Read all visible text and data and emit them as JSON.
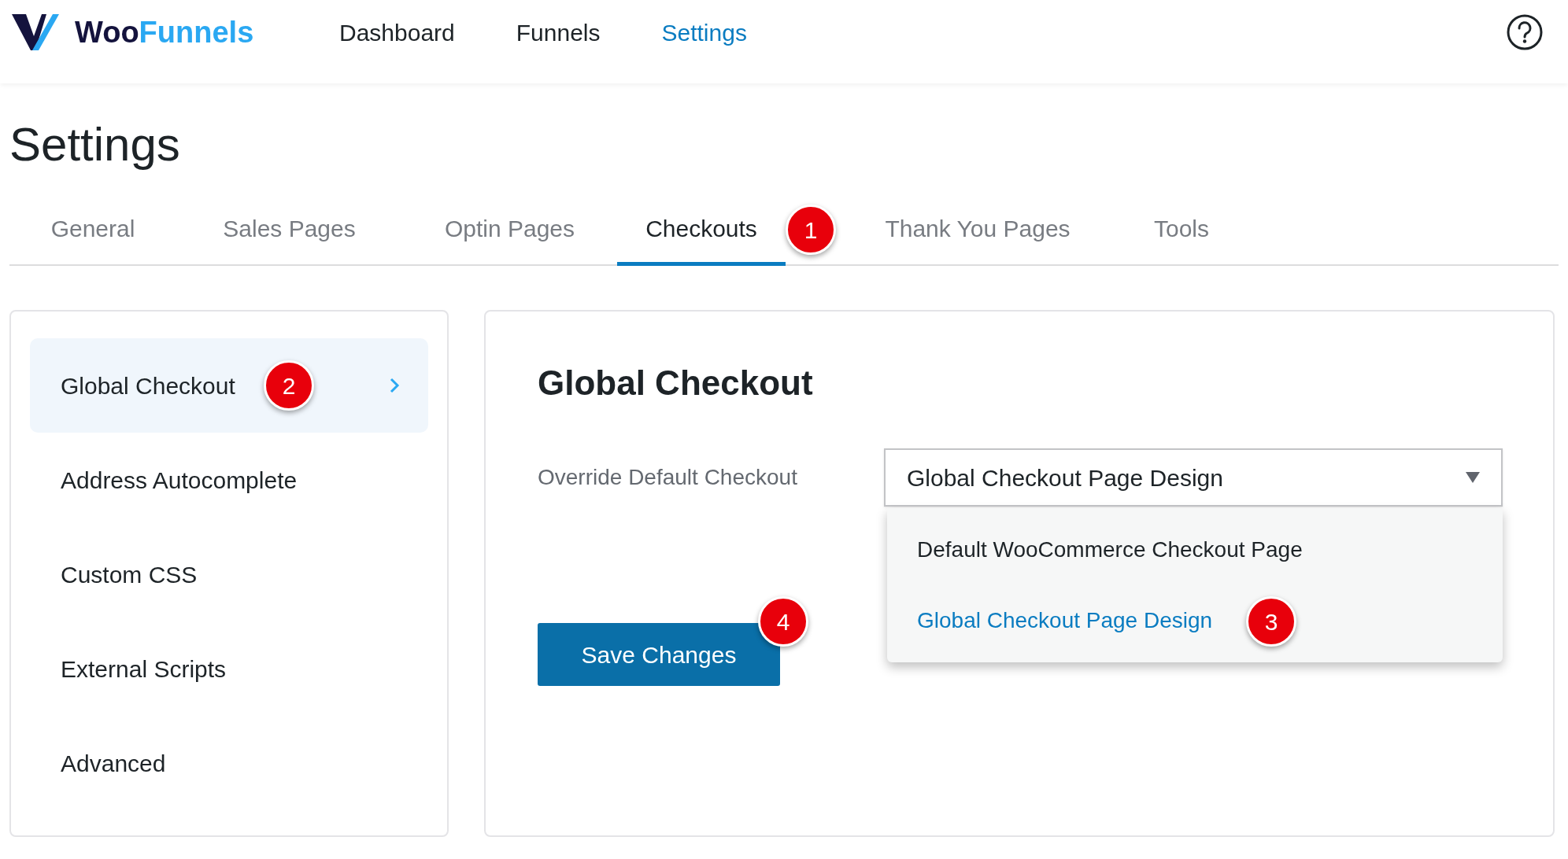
{
  "header": {
    "logo": {
      "part_1": "Woo",
      "part_2": "Funnels"
    },
    "nav": [
      {
        "label": "Dashboard",
        "selected": false
      },
      {
        "label": "Funnels",
        "selected": false
      },
      {
        "label": "Settings",
        "selected": true
      }
    ]
  },
  "page_title": "Settings",
  "tabs": [
    {
      "label": "General",
      "selected": false
    },
    {
      "label": "Sales Pages",
      "selected": false
    },
    {
      "label": "Optin Pages",
      "selected": false
    },
    {
      "label": "Checkouts",
      "selected": true,
      "marker": "1"
    },
    {
      "label": "Thank You Pages",
      "selected": false
    },
    {
      "label": "Tools",
      "selected": false
    }
  ],
  "sidebar": {
    "items": [
      {
        "label": "Global Checkout",
        "selected": true,
        "marker": "2"
      },
      {
        "label": "Address Autocomplete",
        "selected": false
      },
      {
        "label": "Custom CSS",
        "selected": false
      },
      {
        "label": "External Scripts",
        "selected": false
      },
      {
        "label": "Advanced",
        "selected": false
      }
    ]
  },
  "panel": {
    "heading": "Global Checkout",
    "field_label": "Override Default Checkout",
    "select": {
      "value": "Global Checkout Page Design",
      "expanded": true,
      "options": [
        {
          "label": "Default WooCommerce Checkout Page",
          "selected": false
        },
        {
          "label": "Global Checkout Page Design",
          "selected": true,
          "marker": "3"
        }
      ]
    },
    "save_button": {
      "label": "Save Changes",
      "marker": "4"
    }
  }
}
